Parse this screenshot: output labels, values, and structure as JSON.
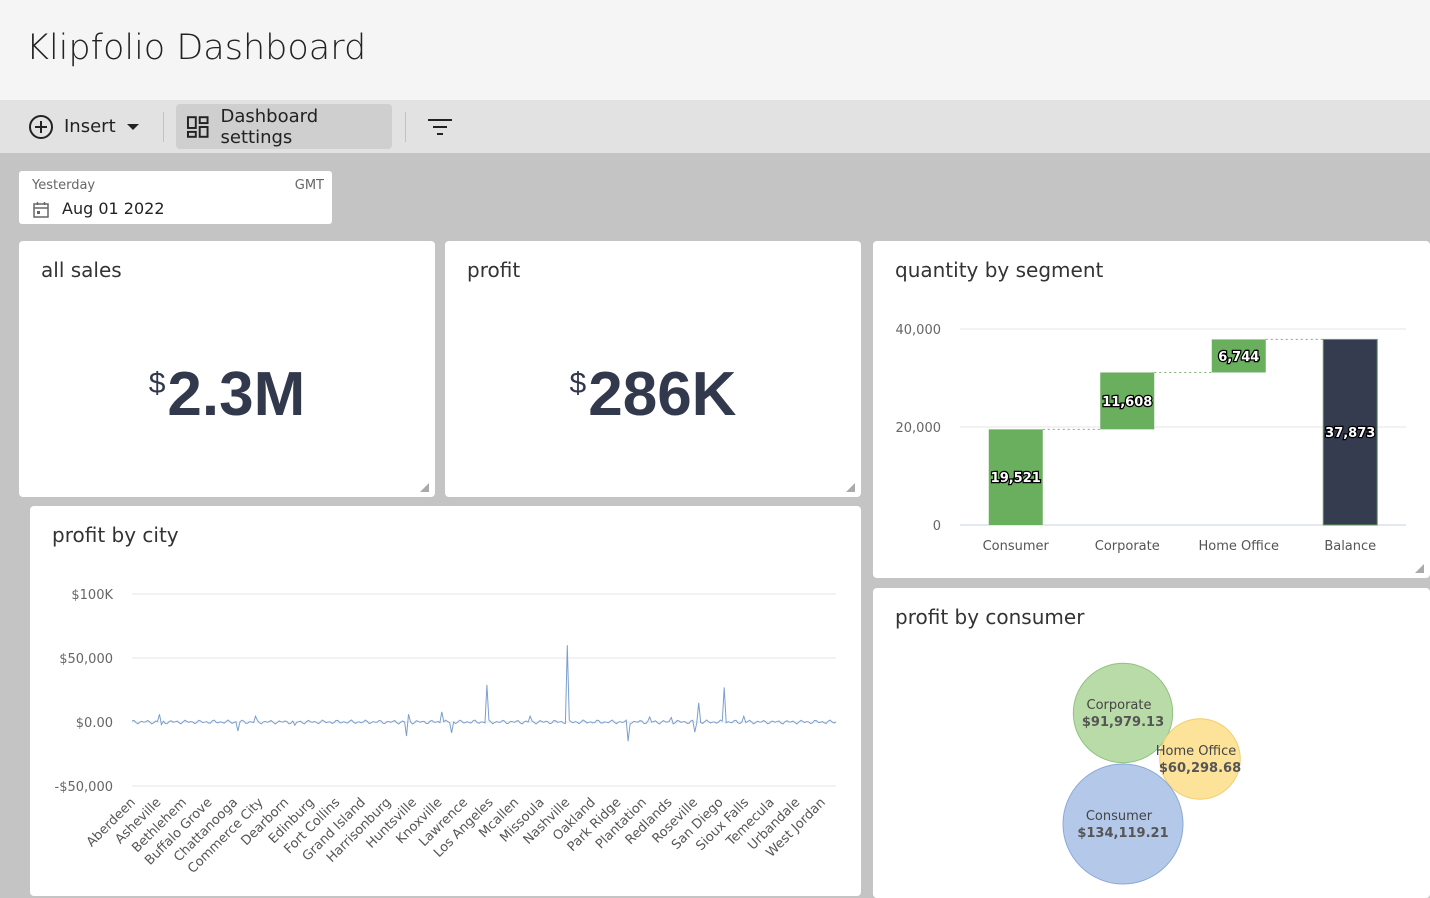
{
  "app": {
    "title": "Klipfolio Dashboard"
  },
  "toolbar": {
    "insert_label": "Insert",
    "settings_label": "Dashboard settings"
  },
  "date_filter": {
    "label": "Yesterday",
    "timezone": "GMT",
    "value": "Aug 01 2022"
  },
  "kpis": {
    "sales": {
      "title": "all sales",
      "currency": "$",
      "value": "2.3M"
    },
    "profit": {
      "title": "profit",
      "currency": "$",
      "value": "286K"
    }
  },
  "icons": [
    "plus-circle-icon",
    "chevron-down-icon",
    "dashboard-grid-icon",
    "filter-icon",
    "calendar-icon",
    "resize-handle-icon"
  ],
  "colors": {
    "green": "#6aaf5e",
    "navy": "#363c4f",
    "line": "#7a9fcf",
    "bubble_green": "#b9dba8",
    "bubble_yellow": "#fde29a",
    "bubble_blue": "#b4c9ea"
  },
  "chart_data": [
    {
      "type": "bar",
      "subtype": "waterfall",
      "title": "quantity by segment",
      "categories": [
        "Consumer",
        "Corporate",
        "Home Office",
        "Balance"
      ],
      "values": [
        19521,
        11608,
        6744,
        37873
      ],
      "labels": [
        "19,521",
        "11,608",
        "6,744",
        "37,873"
      ],
      "yticks": [
        "0",
        "20,000",
        "40,000"
      ],
      "ylim": [
        0,
        40000
      ],
      "grid": true
    },
    {
      "type": "line",
      "title": "profit by city",
      "categories": [
        "Aberdeen",
        "Asheville",
        "Bethlehem",
        "Buffalo Grove",
        "Chattanooga",
        "Commerce City",
        "Dearborn",
        "Edinburg",
        "Fort Collins",
        "Grand Island",
        "Harrisonburg",
        "Huntsville",
        "Knoxville",
        "Lawrence",
        "Los Angeles",
        "Mcallen",
        "Missoula",
        "Nashville",
        "Oakland",
        "Park Ridge",
        "Plantation",
        "Redlands",
        "Roseville",
        "San Diego",
        "Sioux Falls",
        "Temecula",
        "Urbandale",
        "West Jordan"
      ],
      "spikes": [
        {
          "pos": 0.04,
          "value": 6000
        },
        {
          "pos": 0.041,
          "value": -2000
        },
        {
          "pos": 0.15,
          "value": 5000
        },
        {
          "pos": 0.151,
          "value": -7000
        },
        {
          "pos": 0.175,
          "value": 4500
        },
        {
          "pos": 0.23,
          "value": 11000
        },
        {
          "pos": 0.231,
          "value": -2500
        },
        {
          "pos": 0.39,
          "value": -11000
        },
        {
          "pos": 0.393,
          "value": 6000
        },
        {
          "pos": 0.44,
          "value": 8000
        },
        {
          "pos": 0.455,
          "value": -8500
        },
        {
          "pos": 0.505,
          "value": 29000
        },
        {
          "pos": 0.565,
          "value": 4500
        },
        {
          "pos": 0.619,
          "value": 60000
        },
        {
          "pos": 0.705,
          "value": -15000
        },
        {
          "pos": 0.735,
          "value": 4000
        },
        {
          "pos": 0.765,
          "value": 3500
        },
        {
          "pos": 0.8,
          "value": -8000
        },
        {
          "pos": 0.804,
          "value": 15000
        },
        {
          "pos": 0.84,
          "value": 27000
        },
        {
          "pos": 0.869,
          "value": 4500
        }
      ],
      "yticks": [
        "$100K",
        "$50,000",
        "$0.00",
        "-$50,000"
      ],
      "ylim": [
        -50000,
        100000
      ],
      "grid": true
    },
    {
      "type": "bubble",
      "title": "profit by consumer",
      "items": [
        {
          "name": "Corporate",
          "value": 91979.13,
          "label": "$91,979.13",
          "color": "#b9dba8"
        },
        {
          "name": "Home Office",
          "value": 60298.68,
          "label": "$60,298.68",
          "color": "#fde29a"
        },
        {
          "name": "Consumer",
          "value": 134119.21,
          "label": "$134,119.21",
          "color": "#b4c9ea"
        }
      ]
    }
  ]
}
